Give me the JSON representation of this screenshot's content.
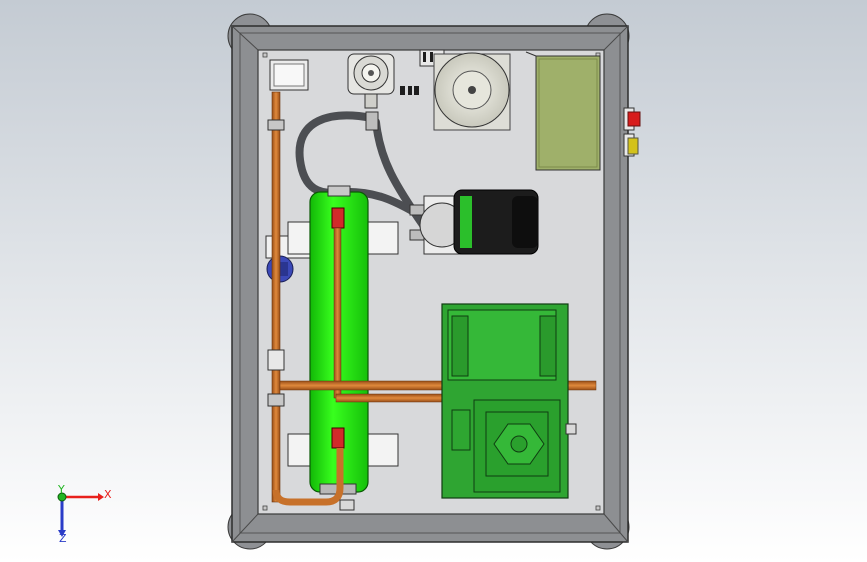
{
  "viewport": {
    "background_top": "#c4cbd3",
    "background_bottom": "#ffffff"
  },
  "triad": {
    "x_label": "X",
    "y_label": "Y",
    "z_label": "Z",
    "x_color": "#e8201c",
    "y_color": "#22b522",
    "z_color": "#2a3cc8"
  },
  "model": {
    "frame_color": "#8d8f92",
    "panel_color": "#d8d9db",
    "heat_exchanger_color": "#22e80a",
    "compressor_color": "#2fa532",
    "pipe_color": "#c7712a",
    "hose_color": "#4c4e52",
    "motor_color": "#1c1c1c",
    "control_box_color": "#9fb06a",
    "valve_color": "#3b49b8",
    "button_red": "#d71c1c",
    "button_yellow": "#d3c21b"
  }
}
